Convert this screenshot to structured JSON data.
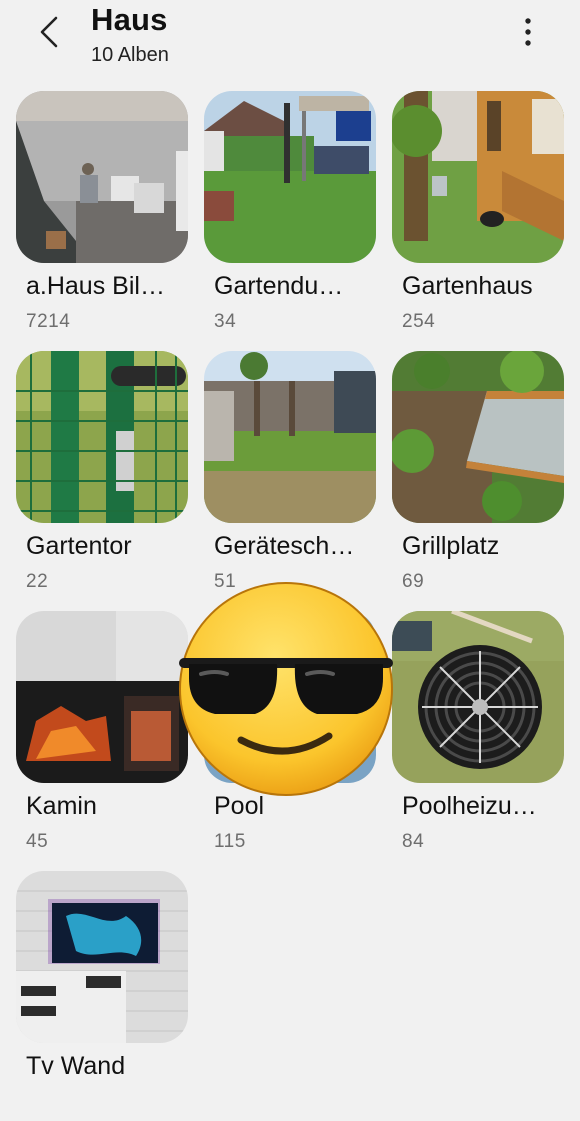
{
  "header": {
    "title": "Haus",
    "subtitle": "10 Alben",
    "back_icon": "back-arrow-icon",
    "more_icon": "more-vertical-icon"
  },
  "albums": [
    {
      "name": "a.Haus Bil…",
      "count": "7214"
    },
    {
      "name": "Gartendu…",
      "count": "34"
    },
    {
      "name": "Gartenhaus",
      "count": "254"
    },
    {
      "name": "Gartentor",
      "count": "22"
    },
    {
      "name": "Gerätesch…",
      "count": "51"
    },
    {
      "name": "Grillplatz",
      "count": "69"
    },
    {
      "name": "Kamin",
      "count": "45"
    },
    {
      "name": "Pool",
      "count": "115"
    },
    {
      "name": "Poolheizu…",
      "count": "84"
    },
    {
      "name": "Tv Wand",
      "count": ""
    }
  ],
  "overlay": {
    "icon": "sunglasses-emoji-icon"
  },
  "colors": {
    "background": "#f1f1f1",
    "count_text": "#6e6e6e"
  }
}
